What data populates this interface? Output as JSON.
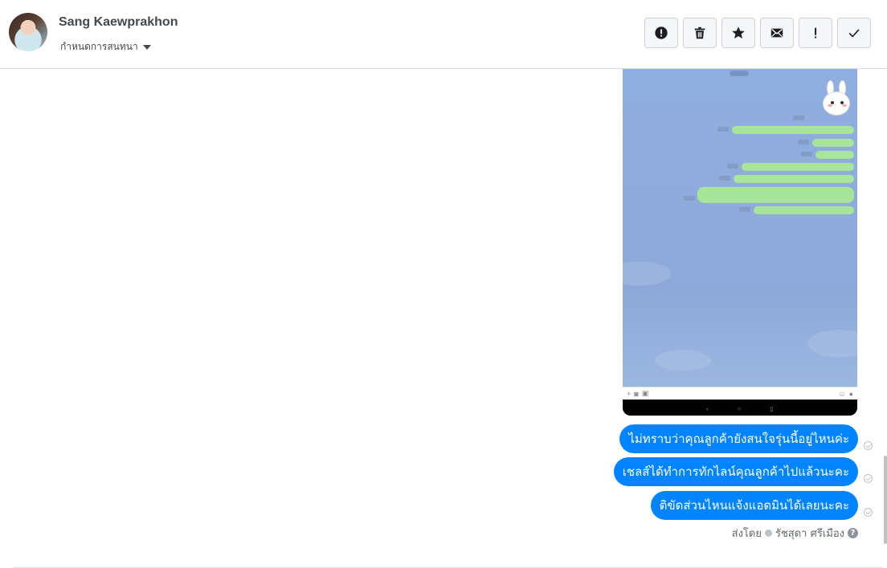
{
  "header": {
    "name": "Sang Kaewprakhon",
    "assign_label": "กำหนดการสนทนา"
  },
  "toolbar": {
    "buttons": [
      {
        "icon": "alert-circle-icon"
      },
      {
        "icon": "trash-icon"
      },
      {
        "icon": "star-icon"
      },
      {
        "icon": "envelope-icon"
      },
      {
        "icon": "exclamation-icon"
      },
      {
        "icon": "checkmark-icon"
      }
    ]
  },
  "messages": [
    {
      "text": "ไม่ทราบว่าคุณลูกค้ายังสนใจรุ่นนี้อยู่ไหนค่ะ"
    },
    {
      "text": "เชลส์ได้ทำการทักไลน์คุณลูกค้าไปแล้วนะคะ"
    },
    {
      "text": "ติขัดส่วนไหนแจ้งแอดมินได้เลยนะคะ"
    }
  ],
  "sent_by": {
    "prefix": "ส่งโดย",
    "agent": "รัชสุดา ศรีเมือง"
  },
  "colors": {
    "bubble": "#0084ff",
    "chat_background": "#8ea9d9",
    "line_bubble": "#a6e59a"
  }
}
